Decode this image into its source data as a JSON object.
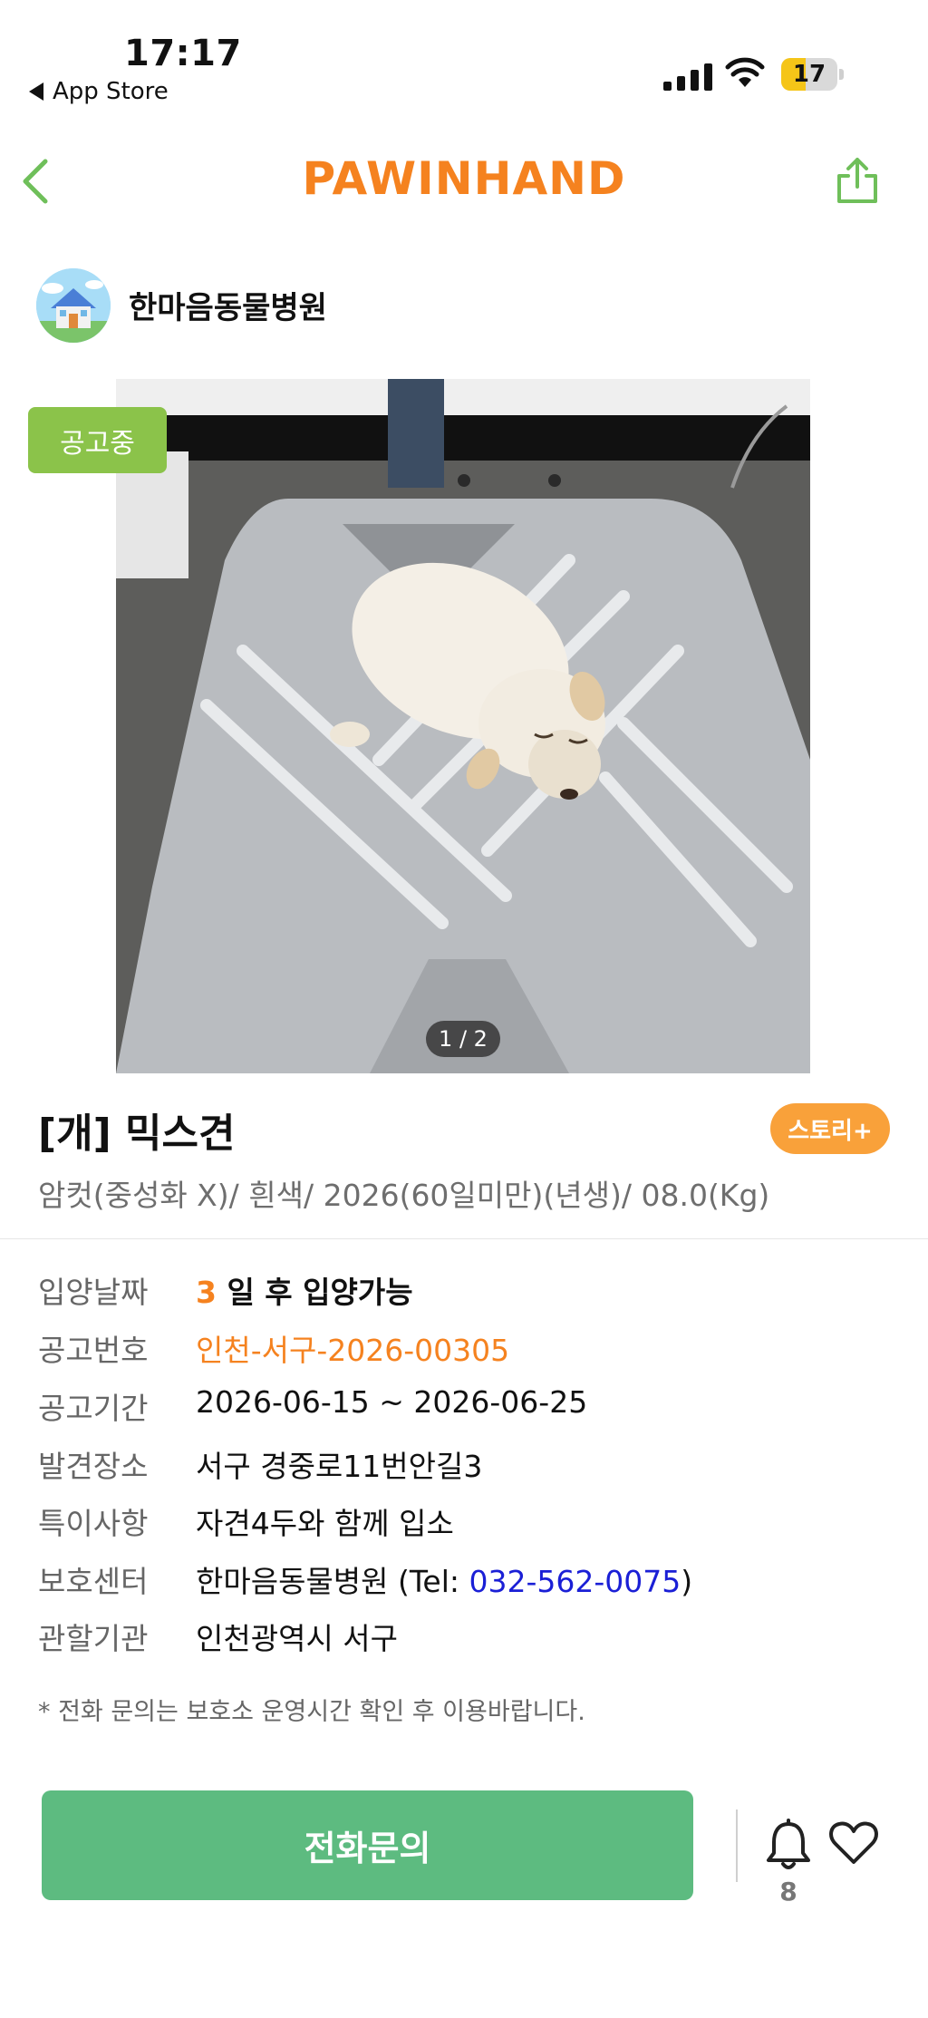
{
  "status_bar": {
    "time": "17:17",
    "back_app": "App Store",
    "battery": "17"
  },
  "header": {
    "brand": "PAWINHAND"
  },
  "organization": {
    "name": "한마음동물병원"
  },
  "photo": {
    "status_badge": "공고중",
    "pager": "1 / 2"
  },
  "animal": {
    "title": "[개] 믹스견",
    "story_button": "스토리+",
    "summary": "암컷(중성화 X)/ 흰색/ 2026(60일미만)(년생)/ 08.0(Kg)"
  },
  "details": {
    "adoption_label": "입양날짜",
    "adoption_days": "3",
    "adoption_suffix": " 일 후 입양가능",
    "notice_no_label": "공고번호",
    "notice_no": "인천-서구-2026-00305",
    "period_label": "공고기간",
    "period": "2026-06-15 ~ 2026-06-25",
    "found_label": "발견장소",
    "found": "서구 경중로11번안길3",
    "special_label": "특이사항",
    "special": "자견4두와 함께 입소",
    "center_label": "보호센터",
    "center_prefix": "한마음동물병원 (Tel: ",
    "center_tel": "032-562-0075",
    "center_suffix": ")",
    "authority_label": "관할기관",
    "authority": "인천광역시 서구"
  },
  "notice_text": "* 전화 문의는 보호소 운영시간 확인 후 이용바랍니다.",
  "actions": {
    "call_button": "전화문의",
    "bell_count": "8"
  },
  "colors": {
    "brand": "#f5821f",
    "status_badge": "#8bc34a",
    "story_button": "#f9a13a",
    "call_button": "#5dbb80",
    "tel_link": "#1a1fd6"
  }
}
